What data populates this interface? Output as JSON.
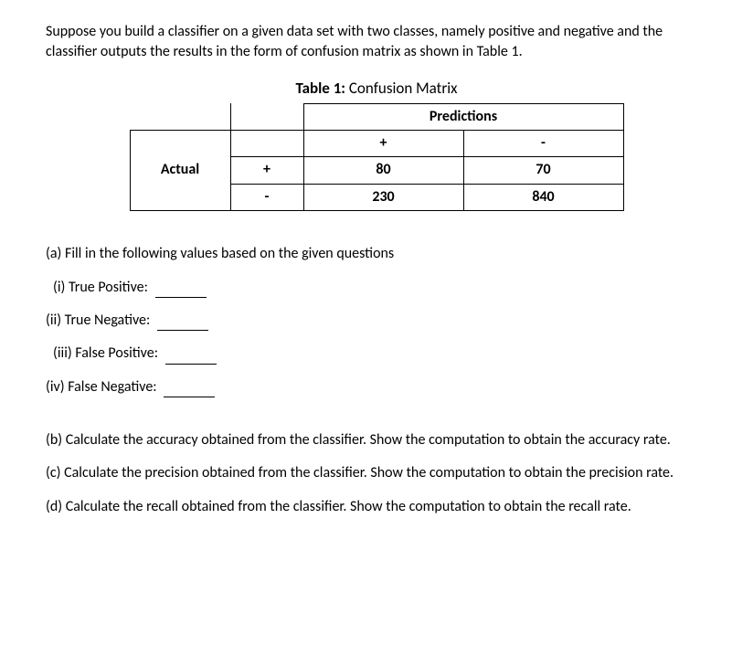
{
  "intro": "Suppose you build a classifier on a given data set with two classes, namely positive and negative and the classifier outputs the results in the form of confusion matrix as shown in Table 1.",
  "table": {
    "title_bold": "Table 1:",
    "title_rest": " Confusion Matrix",
    "predictions_label": "Predictions",
    "actual_label": "Actual",
    "plus": "+",
    "minus": "-",
    "cells": {
      "tp": "80",
      "fn": "70",
      "fp": "230",
      "tn": "840"
    }
  },
  "qa": {
    "lead": "(a) Fill in the following values based on the given questions",
    "i": "(i) True Positive:",
    "ii": "(ii) True Negative:",
    "iii": "(iii) False Positive:",
    "iv": "(iv) False Negative:"
  },
  "qb": "(b) Calculate the accuracy obtained from the classifier. Show the computation to obtain the accuracy rate.",
  "qc": "(c) Calculate the precision obtained from the classifier. Show the computation to obtain the precision rate.",
  "qd": "(d) Calculate the recall obtained from the classifier. Show the computation to obtain the recall rate."
}
